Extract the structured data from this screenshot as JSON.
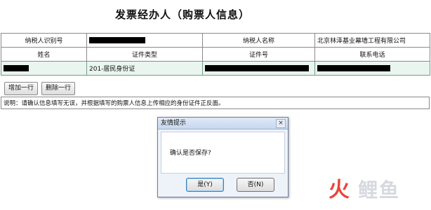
{
  "title": "发票经办人（购票人信息）",
  "table": {
    "row1": {
      "taxpayer_id_label": "纳税人识别号",
      "taxpayer_name_label": "纳税人名称",
      "taxpayer_name_value": "北京林泽基业幕墙工程有限公司"
    },
    "headers": [
      "姓名",
      "证件类型",
      "证件号",
      "联系电话"
    ],
    "data_row": {
      "id_type": "201-居民身份证"
    }
  },
  "buttons": {
    "add_row": "增加一行",
    "delete_row": "删除一行"
  },
  "note": "说明：请确认信息填写无误，并根据填写的购票人信息上传相应的身份证件正反面。",
  "dialog": {
    "title": "友情提示",
    "close_glyph": "×",
    "message": "确认是否保存?",
    "yes_label": "是(Y)",
    "no_label": "否(N)"
  },
  "watermark": {
    "icon_glyph": "火",
    "text": "鲤鱼"
  }
}
